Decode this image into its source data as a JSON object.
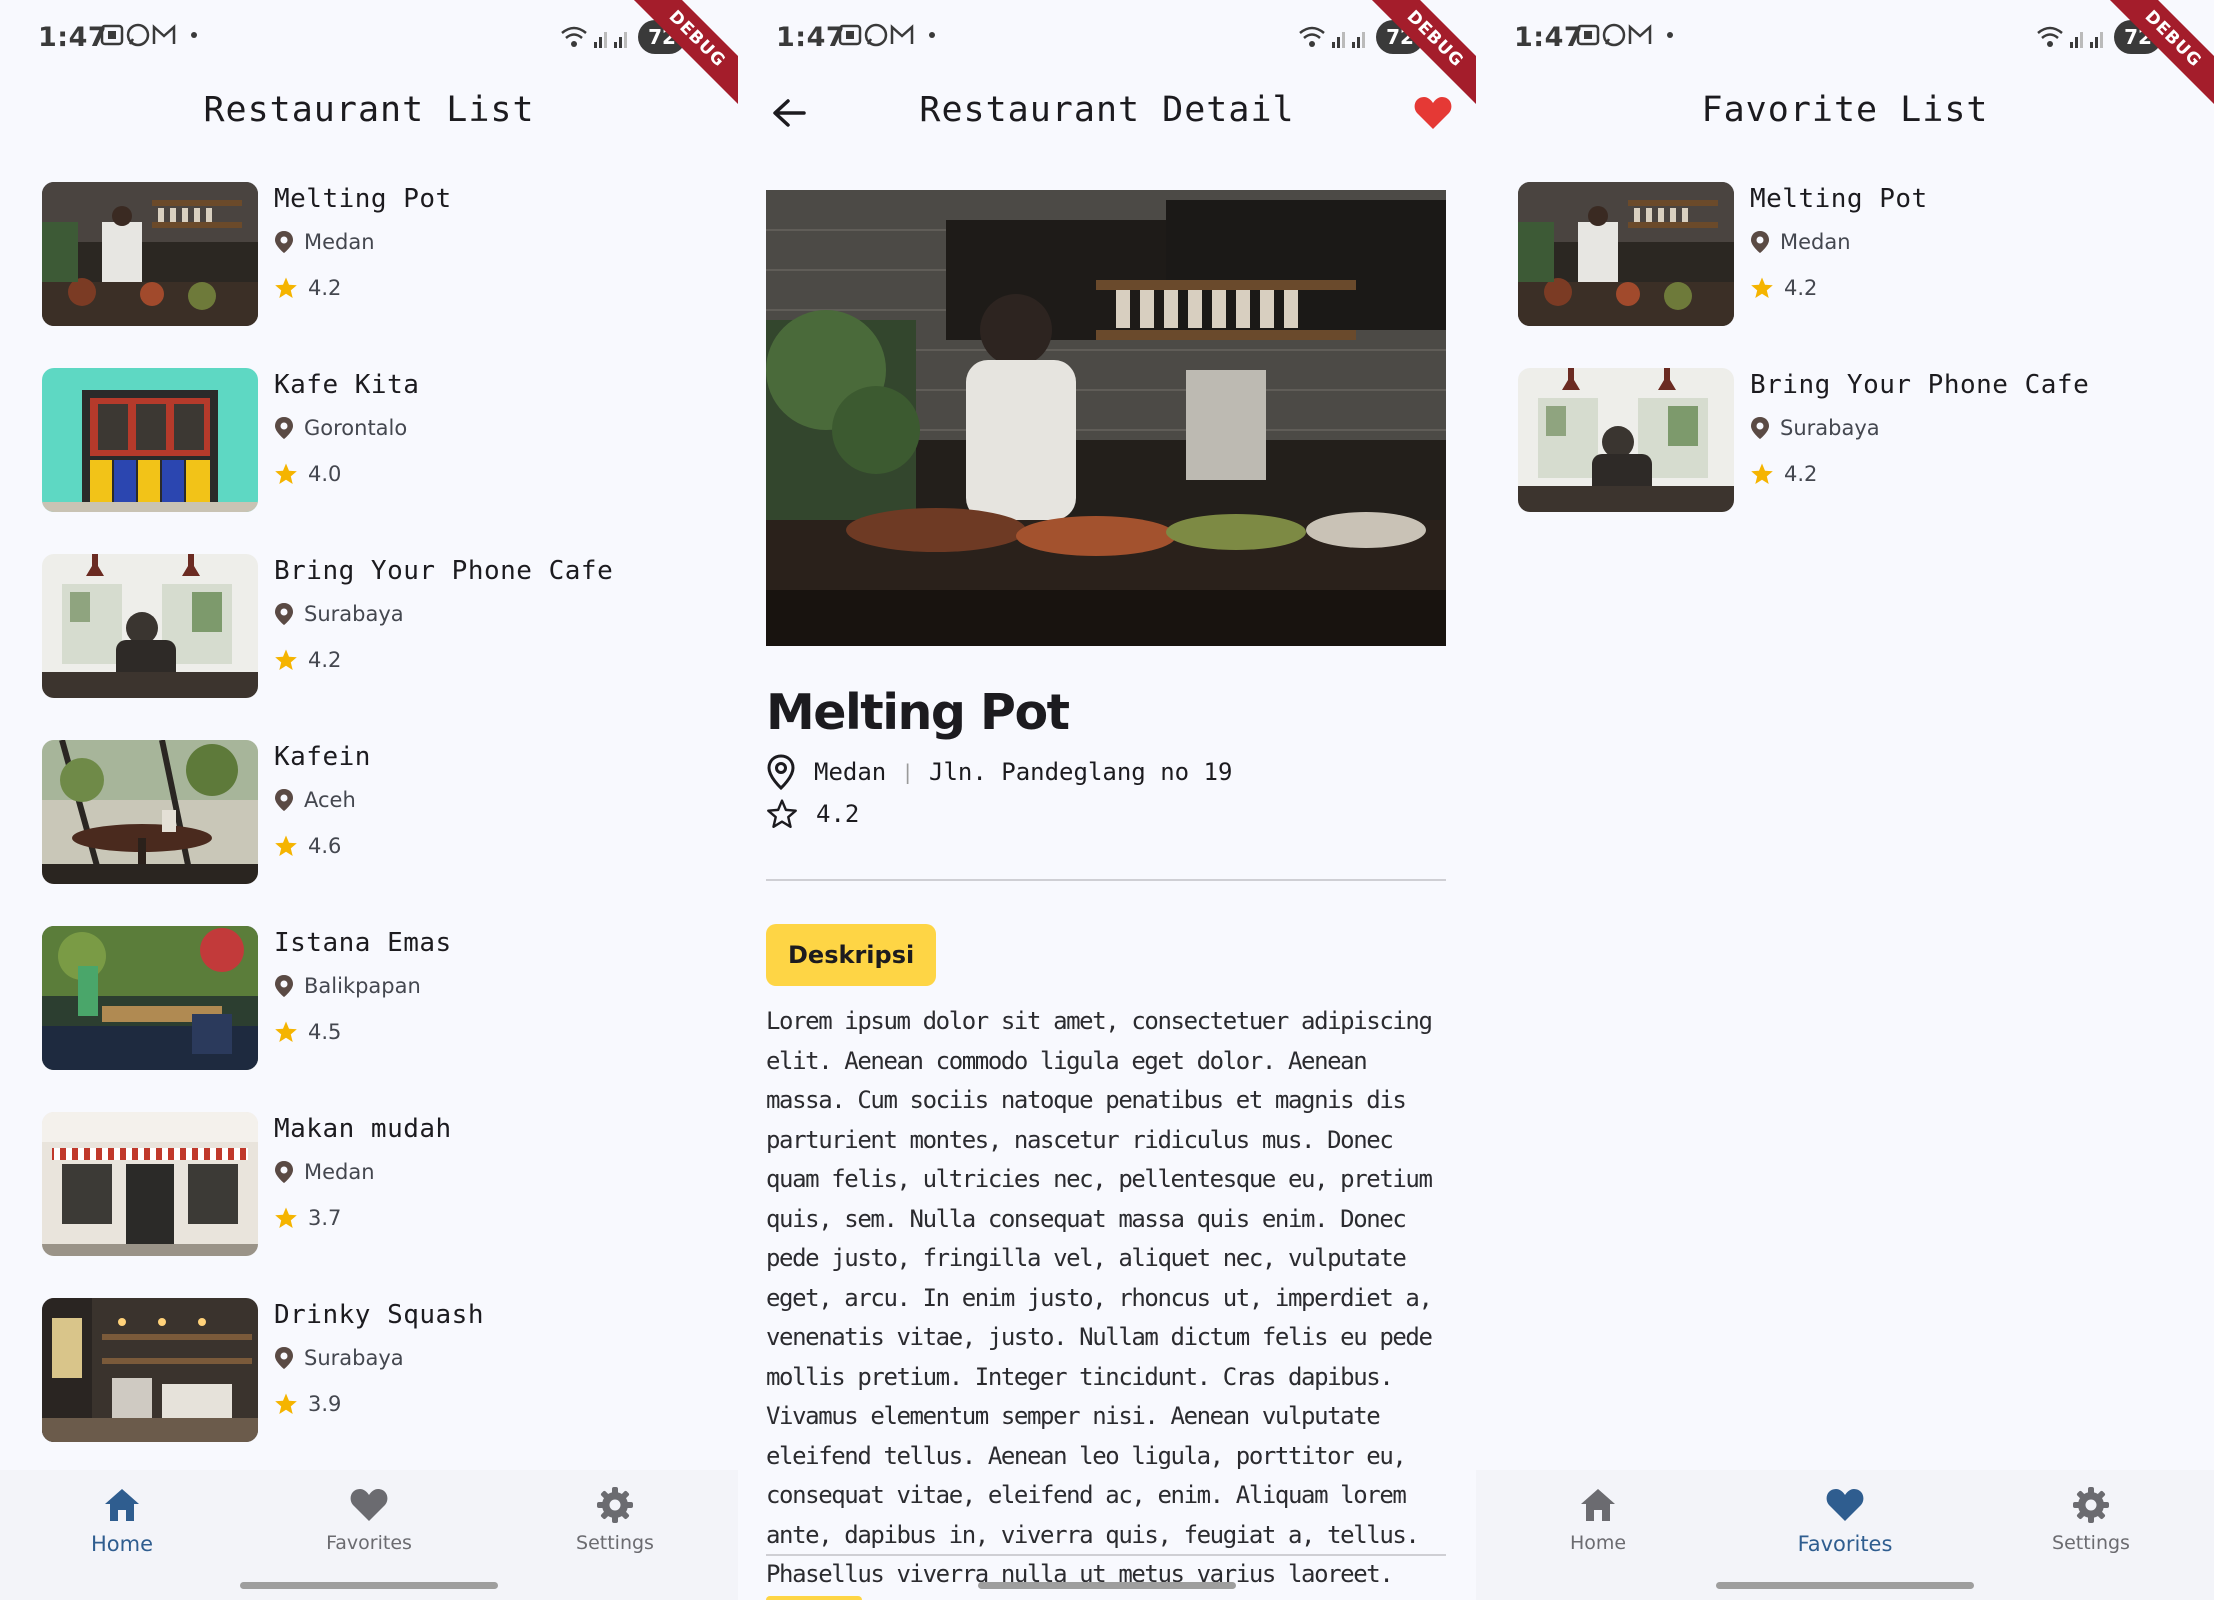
{
  "status_bar": {
    "time": "1:47",
    "battery": "72",
    "debug_label": "DEBUG"
  },
  "colors": {
    "accent": "#fed545",
    "brand_blue": "#2f5d8f",
    "heart_red": "#e53935",
    "star": "#f5b400",
    "background": "#f8f9fe"
  },
  "list_screen": {
    "title": "Restaurant List",
    "restaurants": [
      {
        "name": "Melting Pot",
        "city": "Medan",
        "rating": "4.2",
        "thumb": "kitchen"
      },
      {
        "name": "Kafe Kita",
        "city": "Gorontalo",
        "rating": "4.0",
        "thumb": "colorful-storefront"
      },
      {
        "name": "Bring Your Phone Cafe",
        "city": "Surabaya",
        "rating": "4.2",
        "thumb": "cafe-window"
      },
      {
        "name": "Kafein",
        "city": "Aceh",
        "rating": "4.6",
        "thumb": "cafe-table-plants"
      },
      {
        "name": "Istana Emas",
        "city": "Balikpapan",
        "rating": "4.5",
        "thumb": "green-cafe"
      },
      {
        "name": "Makan mudah",
        "city": "Medan",
        "rating": "3.7",
        "thumb": "striped-awning-storefront"
      },
      {
        "name": "Drinky Squash",
        "city": "Surabaya",
        "rating": "3.9",
        "thumb": "coffee-bar"
      }
    ]
  },
  "detail_screen": {
    "title": "Restaurant Detail",
    "name": "Melting Pot",
    "city": "Medan",
    "address": "Jln. Pandeglang no 19",
    "rating": "4.2",
    "is_favorite": true,
    "section_label": "Deskripsi",
    "description": "Lorem ipsum dolor sit amet, consectetuer adipiscing elit. Aenean commodo ligula eget dolor. Aenean massa. Cum sociis natoque penatibus et magnis dis parturient montes, nascetur ridiculus mus. Donec quam felis, ultricies nec, pellentesque eu, pretium quis, sem. Nulla consequat massa quis enim. Donec pede justo, fringilla vel, aliquet nec, vulputate eget, arcu. In enim justo, rhoncus ut, imperdiet a, venenatis vitae, justo. Nullam dictum felis eu pede mollis pretium. Integer tincidunt. Cras dapibus. Vivamus elementum semper nisi. Aenean vulputate eleifend tellus. Aenean leo ligula, porttitor eu, consequat vitae, eleifend ac, enim. Aliquam lorem ante, dapibus in, viverra quis, feugiat a, tellus. Phasellus viverra nulla ut metus varius laoreet."
  },
  "favorite_screen": {
    "title": "Favorite List",
    "restaurants": [
      {
        "name": "Melting Pot",
        "city": "Medan",
        "rating": "4.2",
        "thumb": "kitchen"
      },
      {
        "name": "Bring Your Phone Cafe",
        "city": "Surabaya",
        "rating": "4.2",
        "thumb": "cafe-window"
      }
    ]
  },
  "bottom_nav": {
    "items": [
      {
        "label": "Home",
        "icon": "home-icon"
      },
      {
        "label": "Favorites",
        "icon": "heart-icon"
      },
      {
        "label": "Settings",
        "icon": "gear-icon"
      }
    ]
  }
}
